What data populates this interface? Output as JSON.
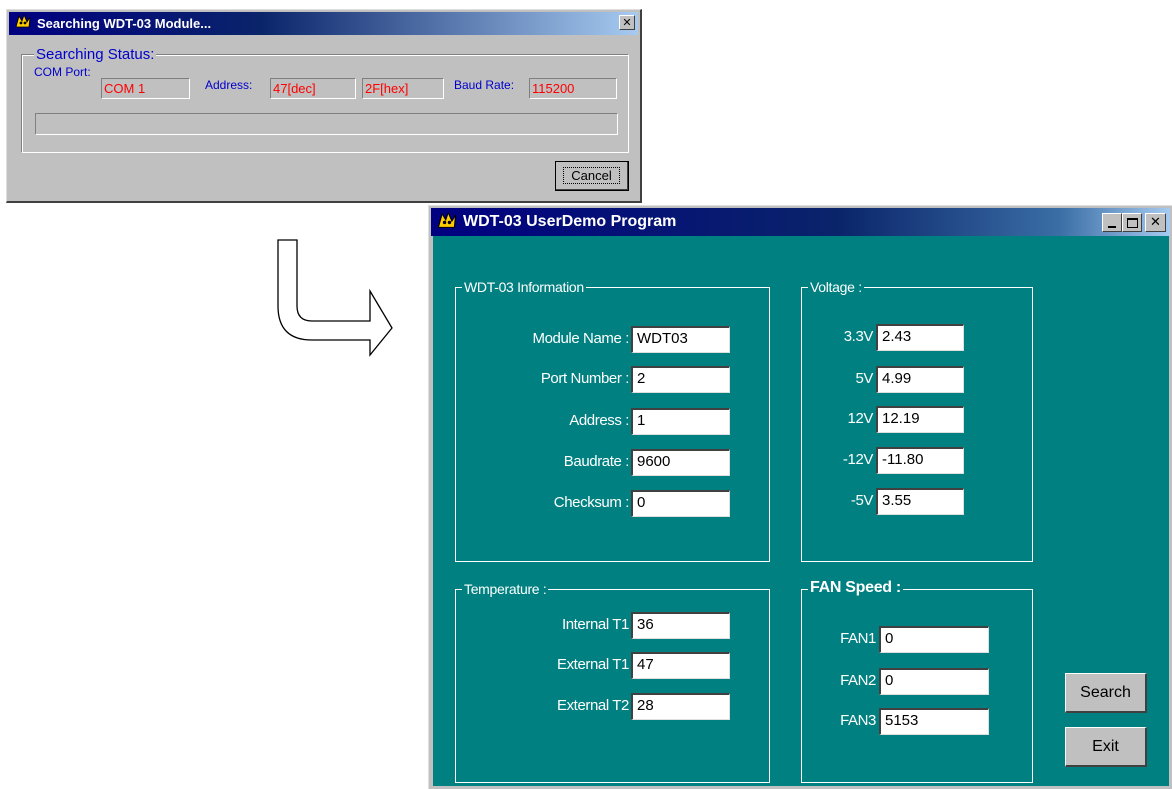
{
  "search_dialog": {
    "title": "Searching WDT-03 Module...",
    "status_group_label": "Searching Status:",
    "com_port_label": "COM Port:",
    "com_port_value": "COM 1",
    "address_label": "Address:",
    "address_dec": "47[dec]",
    "address_hex": "2F[hex]",
    "baud_rate_label": "Baud Rate:",
    "baud_rate_value": "115200",
    "cancel_label": "Cancel",
    "close_glyph": "✕",
    "progress": 0
  },
  "main_window": {
    "title": "WDT-03 UserDemo Program",
    "info_group": {
      "label": "WDT-03 Information",
      "rows": [
        {
          "label": "Module Name :",
          "value": "WDT03"
        },
        {
          "label": "Port Number :",
          "value": "2"
        },
        {
          "label": "Address :",
          "value": "1"
        },
        {
          "label": "Baudrate :",
          "value": "9600"
        },
        {
          "label": "Checksum :",
          "value": "0"
        }
      ]
    },
    "voltage_group": {
      "label": "Voltage :",
      "rows": [
        {
          "label": "3.3V",
          "value": "2.43"
        },
        {
          "label": "5V",
          "value": "4.99"
        },
        {
          "label": "12V",
          "value": "12.19"
        },
        {
          "label": "-12V",
          "value": "-11.80"
        },
        {
          "label": "-5V",
          "value": "3.55"
        }
      ]
    },
    "temperature_group": {
      "label": "Temperature :",
      "rows": [
        {
          "label": "Internal T1",
          "value": "36"
        },
        {
          "label": "External T1",
          "value": "47"
        },
        {
          "label": "External T2",
          "value": "28"
        }
      ]
    },
    "fan_group": {
      "label": "FAN Speed :",
      "rows": [
        {
          "label": "FAN1",
          "value": "0"
        },
        {
          "label": "FAN2",
          "value": "0"
        },
        {
          "label": "FAN3",
          "value": "5153"
        }
      ]
    },
    "search_label": "Search",
    "exit_label": "Exit"
  },
  "colors": {
    "titlebar_active": "#000080",
    "client_background": "#008080",
    "status_text": "#0000cc",
    "value_text_red": "#ff0000"
  },
  "icons": [
    "app-icon",
    "close-icon",
    "minimize-icon",
    "maximize-icon",
    "flow-arrow-icon"
  ]
}
